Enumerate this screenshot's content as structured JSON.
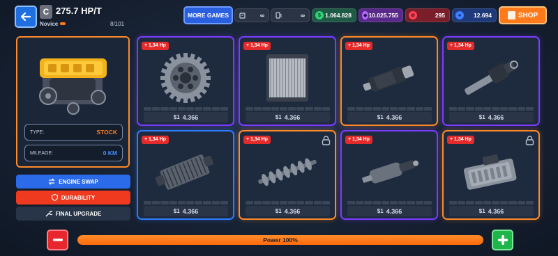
{
  "header": {
    "class_letter": "C",
    "hp_value": "275.7 HP/T",
    "rank": "Novice",
    "rank_progress": 0.1,
    "progress": "8/101",
    "more_games_label": "MORE GAMES",
    "shop_label": "SHOP"
  },
  "currencies": [
    {
      "icon": "fuel-can-icon",
      "value": "∞",
      "color": "#2a3444"
    },
    {
      "icon": "gas-pump-icon",
      "value": "∞",
      "color": "#2a3444"
    },
    {
      "icon": "cash-icon",
      "value": "1.064.828",
      "color": "#1f5a46"
    },
    {
      "icon": "gem-icon",
      "value": "10.025.755",
      "color": "#5a2a8a"
    },
    {
      "icon": "ticket-icon",
      "value": "295",
      "color": "#7a1f2a"
    },
    {
      "icon": "token-icon",
      "value": "12.694",
      "color": "#1f3a7a"
    }
  ],
  "engine": {
    "type_label": "TYPE:",
    "type_value": "STOCK",
    "mileage_label": "MILEAGE:",
    "mileage_value": "0 KM"
  },
  "actions": {
    "engine_swap": "ENGINE SWAP",
    "durability": "DURABILITY",
    "final_upgrade": "FINAL UPGRADE"
  },
  "parts": [
    {
      "name": "gear",
      "hp": "+ 1,34 Hp",
      "price": "4.366",
      "locked": false,
      "border": "#7a3cff",
      "progress": 0
    },
    {
      "name": "radiator",
      "hp": "+ 1,34 Hp",
      "price": "4.366",
      "locked": false,
      "border": "#7a3cff",
      "progress": 0
    },
    {
      "name": "fuel-pump",
      "hp": "+ 1,34 Hp",
      "price": "4.366",
      "locked": false,
      "border": "#ff8a2a",
      "progress": 0
    },
    {
      "name": "injector",
      "hp": "+ 1,34 Hp",
      "price": "4.366",
      "locked": false,
      "border": "#7a3cff",
      "progress": 0
    },
    {
      "name": "intercooler",
      "hp": "+ 1,34 Hp",
      "price": "4.366",
      "locked": false,
      "border": "#2f7cff",
      "progress": 0
    },
    {
      "name": "camshaft",
      "hp": "+ 1,34 Hp",
      "price": "4.366",
      "locked": true,
      "border": "#ff8a2a",
      "progress": 0
    },
    {
      "name": "filter",
      "hp": "+ 1,34 Hp",
      "price": "4.366",
      "locked": false,
      "border": "#7a3cff",
      "progress": 0
    },
    {
      "name": "ecu",
      "hp": "+ 1,34 Hp",
      "price": "4.366",
      "locked": true,
      "border": "#ff8a2a",
      "progress": 0
    }
  ],
  "power": {
    "label": "Power 100%",
    "level": 1.0
  }
}
